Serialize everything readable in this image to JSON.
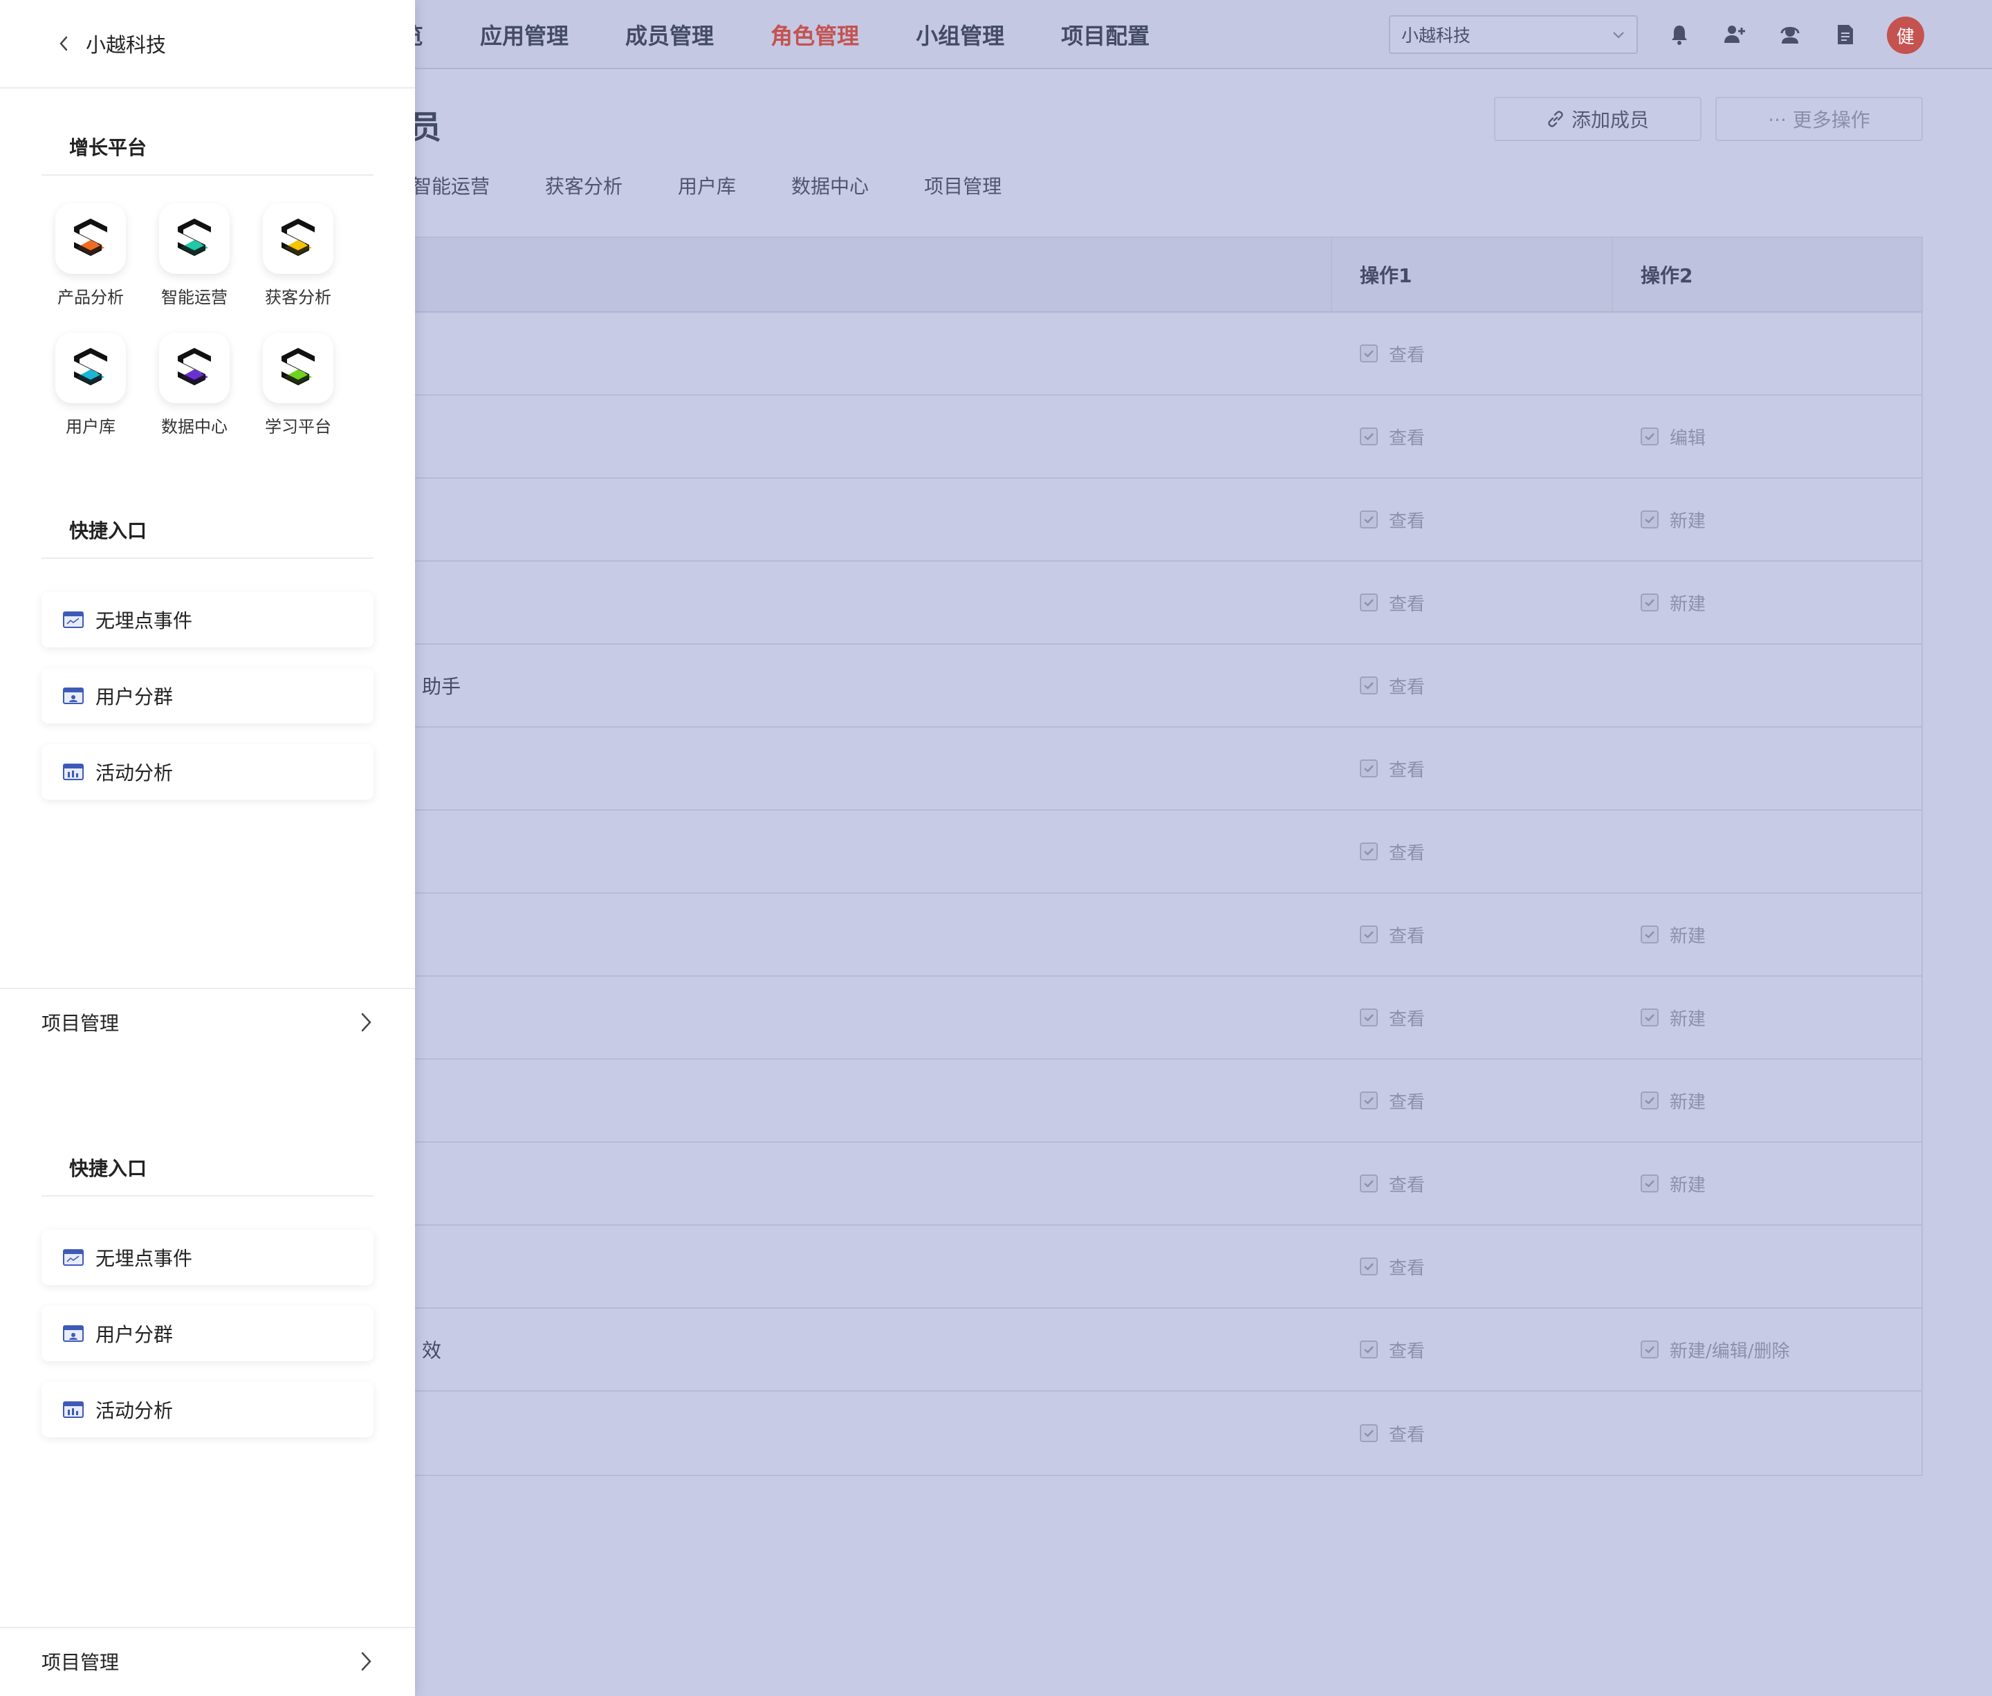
{
  "topbar": {
    "nav": [
      "览",
      "应用管理",
      "成员管理",
      "角色管理",
      "小组管理",
      "项目配置"
    ],
    "active_nav": "角色管理",
    "org_select_value": "小越科技",
    "avatar_text": "健",
    "icons": [
      "bell-icon",
      "add-user-icon",
      "support-icon",
      "document-icon"
    ]
  },
  "page": {
    "title": "员",
    "add_member_label": "添加成员",
    "more_actions_label": "··· 更多操作"
  },
  "tabs": [
    "智能运营",
    "获客分析",
    "用户库",
    "数据中心",
    "项目管理"
  ],
  "table": {
    "headers": [
      "",
      "操作1",
      "操作2"
    ],
    "rows": [
      {
        "name": "",
        "op1": "查看",
        "op2": ""
      },
      {
        "name": "",
        "op1": "查看",
        "op2": "编辑"
      },
      {
        "name": "",
        "op1": "查看",
        "op2": "新建"
      },
      {
        "name": "",
        "op1": "查看",
        "op2": "新建"
      },
      {
        "name": "助手",
        "op1": "查看",
        "op2": ""
      },
      {
        "name": "",
        "op1": "查看",
        "op2": ""
      },
      {
        "name": "",
        "op1": "查看",
        "op2": ""
      },
      {
        "name": "",
        "op1": "查看",
        "op2": "新建"
      },
      {
        "name": "",
        "op1": "查看",
        "op2": "新建"
      },
      {
        "name": "",
        "op1": "查看",
        "op2": "新建"
      },
      {
        "name": "",
        "op1": "查看",
        "op2": "新建"
      },
      {
        "name": "",
        "op1": "查看",
        "op2": ""
      },
      {
        "name": "效",
        "op1": "查看",
        "op2": "新建/编辑/删除"
      },
      {
        "name": "",
        "op1": "查看",
        "op2": ""
      }
    ]
  },
  "drawer": {
    "title": "小越科技",
    "growth_title": "增长平台",
    "apps": [
      {
        "label": "产品分析",
        "color": "#f26b1d",
        "icon": "product-analysis-icon"
      },
      {
        "label": "智能运营",
        "color": "#1fc8a6",
        "icon": "smart-ops-icon"
      },
      {
        "label": "获客分析",
        "color": "#f5c400",
        "icon": "acquisition-icon"
      },
      {
        "label": "用户库",
        "color": "#19b6d8",
        "icon": "user-library-icon"
      },
      {
        "label": "数据中心",
        "color": "#6a2fd6",
        "icon": "data-center-icon"
      },
      {
        "label": "学习平台",
        "color": "#6fd21c",
        "icon": "learning-platform-icon"
      }
    ],
    "quick_title_1": "快捷入口",
    "quick_items_1": [
      "无埋点事件",
      "用户分群",
      "活动分析"
    ],
    "footer_1": "项目管理",
    "quick_title_2": "快捷入口",
    "quick_items_2": [
      "无埋点事件",
      "用户分群",
      "活动分析"
    ],
    "footer_2": "项目管理"
  }
}
